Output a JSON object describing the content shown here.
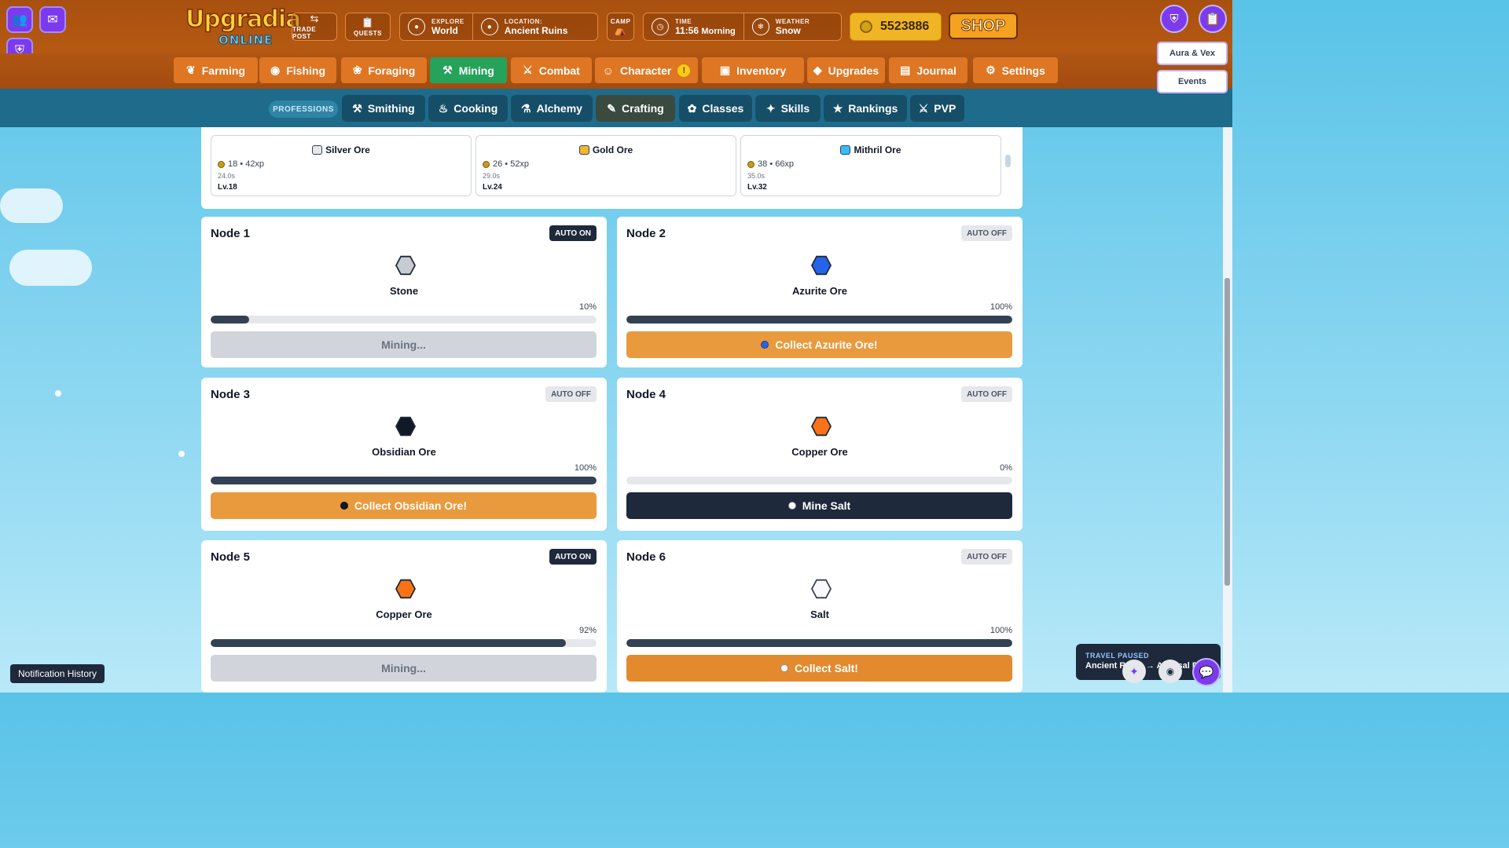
{
  "topbar": {
    "logo_line1": "Upgradia",
    "logo_line2": "ONLINE",
    "trade_post": "TRADE POST",
    "quests": "QUESTS",
    "explore_cap": "EXPLORE",
    "explore_val": "World",
    "location_cap": "LOCATION:",
    "location_val": "Ancient Ruins",
    "camp": "CAMP",
    "time_cap": "TIME",
    "time_val": "11:56",
    "time_period": "Morning",
    "weather_cap": "WEATHER",
    "weather_val": "Snow",
    "gold": "5523886",
    "shop": "SHOP"
  },
  "main_nav": [
    {
      "label": "Farming",
      "icon": "sprout-icon"
    },
    {
      "label": "Fishing",
      "icon": "fish-icon"
    },
    {
      "label": "Foraging",
      "icon": "leaf-icon"
    },
    {
      "label": "Mining",
      "icon": "pickaxe-icon",
      "active": true
    },
    {
      "label": "Combat",
      "icon": "swords-icon"
    },
    {
      "label": "Character",
      "icon": "user-icon",
      "badge": "!"
    },
    {
      "label": "Inventory",
      "icon": "box-icon"
    },
    {
      "label": "Upgrades",
      "icon": "gem-icon"
    },
    {
      "label": "Journal",
      "icon": "book-icon"
    },
    {
      "label": "Settings",
      "icon": "gear-icon"
    }
  ],
  "prof_nav": {
    "label": "PROFESSIONS",
    "items": [
      {
        "label": "Smithing",
        "icon": "hammer-icon"
      },
      {
        "label": "Cooking",
        "icon": "chef-hat-icon"
      },
      {
        "label": "Alchemy",
        "icon": "flask-icon"
      },
      {
        "label": "Crafting",
        "icon": "brush-icon"
      },
      {
        "label": "Classes",
        "icon": "classes-icon"
      },
      {
        "label": "Skills",
        "icon": "sparkles-icon"
      },
      {
        "label": "Rankings",
        "icon": "trophy-icon"
      },
      {
        "label": "PVP",
        "icon": "sword-icon"
      }
    ]
  },
  "right_panel": {
    "aura_vex": "Aura & Vex",
    "events": "Events"
  },
  "ore_list": [
    {
      "name": "Silver Ore",
      "stat": "18 • 42xp",
      "time": "24.0s",
      "level": "Lv.18",
      "color": "#e5e7eb"
    },
    {
      "name": "Gold Ore",
      "stat": "26 • 52xp",
      "time": "29.0s",
      "level": "Lv.24",
      "color": "#f1b82d"
    },
    {
      "name": "Mithril Ore",
      "stat": "38 • 66xp",
      "time": "35.0s",
      "level": "Lv.32",
      "color": "#38bdf8"
    }
  ],
  "nodes": [
    {
      "title": "Node 1",
      "auto": "AUTO ON",
      "ore": "Stone",
      "percent": "10%",
      "progress": 0.1,
      "action": "Mining...",
      "color": "#c7ccd3"
    },
    {
      "title": "Node 2",
      "auto": "AUTO OFF",
      "ore": "Azurite Ore",
      "percent": "100%",
      "progress": 1.0,
      "action": "Collect Azurite Ore!",
      "color": "#2563eb"
    },
    {
      "title": "Node 3",
      "auto": "AUTO OFF",
      "ore": "Obsidian Ore",
      "percent": "100%",
      "progress": 1.0,
      "action": "Collect Obsidian Ore!",
      "color": "#111827"
    },
    {
      "title": "Node 4",
      "auto": "AUTO OFF",
      "ore": "Copper Ore",
      "percent": "0%",
      "progress": 0.0,
      "action": "Mine Salt",
      "color": "#f97316"
    },
    {
      "title": "Node 5",
      "auto": "AUTO ON",
      "ore": "Copper Ore",
      "percent": "92%",
      "progress": 0.92,
      "action": "Mining...",
      "color": "#f97316"
    },
    {
      "title": "Node 6",
      "auto": "AUTO OFF",
      "ore": "Salt",
      "percent": "100%",
      "progress": 1.0,
      "action": "Collect Salt!",
      "color": "#f8fafc"
    }
  ],
  "footer": {
    "notification_history": "Notification History",
    "travel_cap": "TRAVEL PAUSED",
    "travel_val": "Ancient Ruins → Abyssal Depths"
  }
}
